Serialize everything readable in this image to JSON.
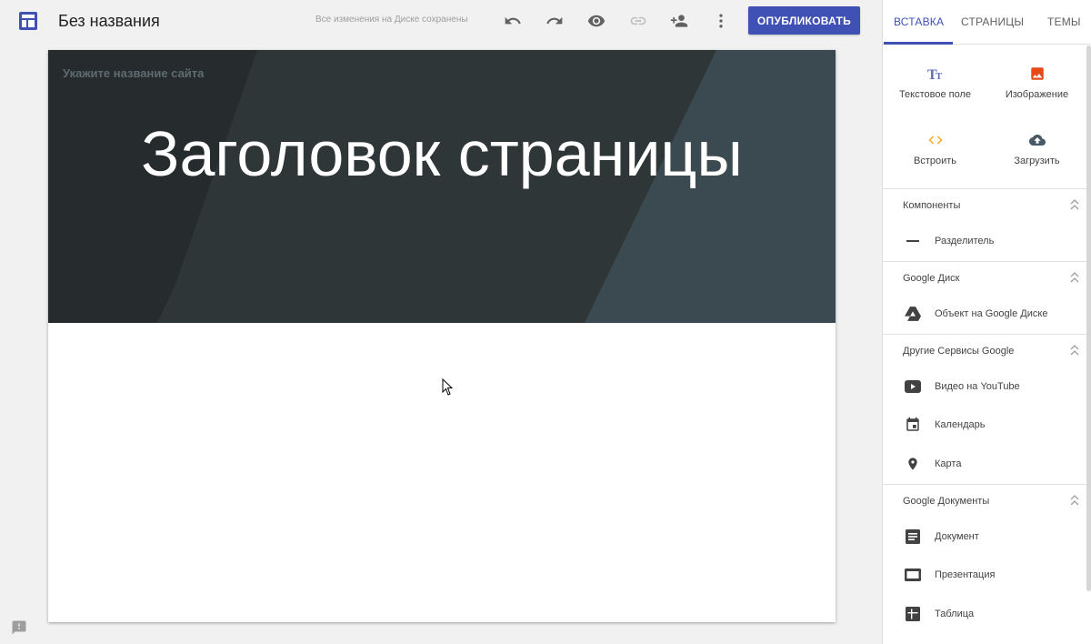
{
  "header": {
    "logo_icon": "google-sites-logo-icon",
    "site_title": "Без названия",
    "save_status": "Все изменения на Диске сохранены",
    "publish_label": "ОПУБЛИКОВАТЬ",
    "toolbar_icons": [
      "undo-icon",
      "redo-icon",
      "preview-icon",
      "link-icon",
      "add-person-icon",
      "more-vert-icon"
    ]
  },
  "canvas": {
    "site_name_placeholder": "Укажите название сайта",
    "page_title": "Заголовок страницы"
  },
  "panel": {
    "tabs": [
      {
        "label": "ВСТАВКА",
        "active": true
      },
      {
        "label": "СТРАНИЦЫ",
        "active": false
      },
      {
        "label": "ТЕМЫ",
        "active": false
      }
    ],
    "quick_insert": [
      {
        "label": "Текстовое поле",
        "icon": "text-box-icon"
      },
      {
        "label": "Изображение",
        "icon": "image-icon"
      },
      {
        "label": "Встроить",
        "icon": "embed-icon"
      },
      {
        "label": "Загрузить",
        "icon": "upload-icon"
      }
    ],
    "sections": [
      {
        "title": "Компоненты",
        "items": [
          {
            "label": "Разделитель",
            "icon": "divider-icon"
          }
        ]
      },
      {
        "title": "Google Диск",
        "items": [
          {
            "label": "Объект на Google Диске",
            "icon": "drive-icon"
          }
        ]
      },
      {
        "title": "Другие Сервисы Google",
        "items": [
          {
            "label": "Видео на YouTube",
            "icon": "youtube-icon"
          },
          {
            "label": "Календарь",
            "icon": "calendar-icon"
          },
          {
            "label": "Карта",
            "icon": "map-pin-icon"
          }
        ]
      },
      {
        "title": "Google Документы",
        "items": [
          {
            "label": "Документ",
            "icon": "document-icon"
          },
          {
            "label": "Презентация",
            "icon": "presentation-icon"
          },
          {
            "label": "Таблица",
            "icon": "spreadsheet-icon"
          }
        ]
      }
    ]
  },
  "colors": {
    "accent": "#3f51b5",
    "hero_bg": "#2c3336",
    "text_icon_color": "#5c6bc0",
    "image_icon_color": "#e64a19",
    "embed_icon_color": "#f9a825",
    "upload_icon_color": "#455a64"
  }
}
